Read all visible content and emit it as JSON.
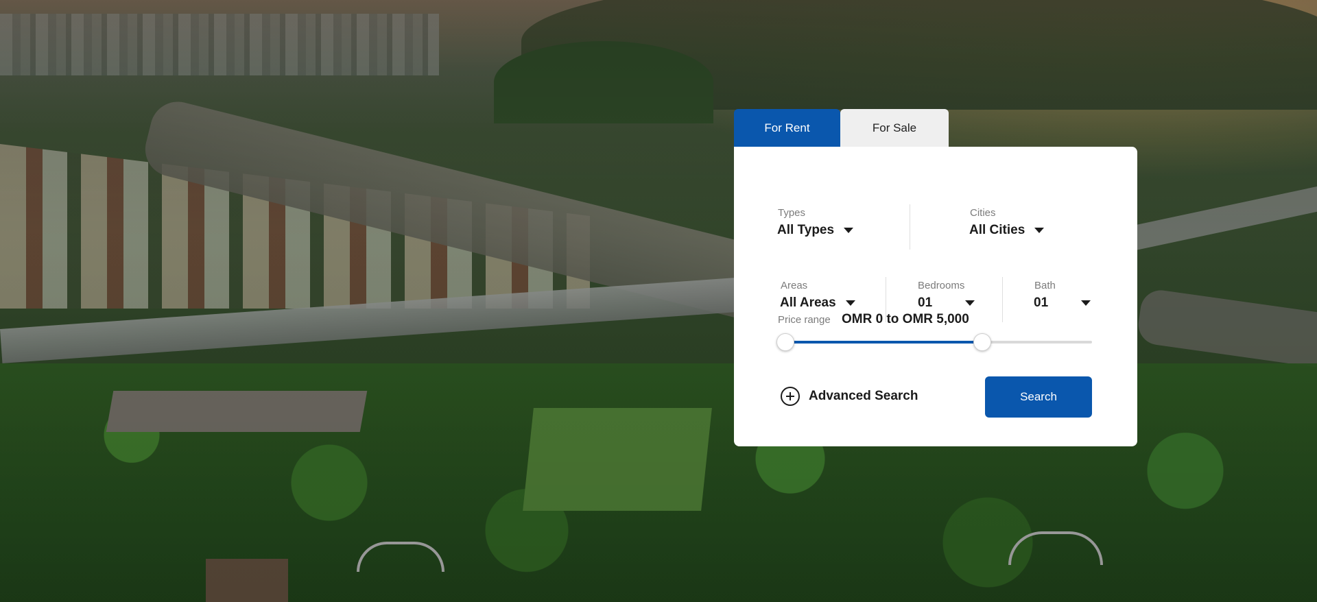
{
  "tabs": [
    {
      "label": "For Rent",
      "active": true
    },
    {
      "label": "For Sale",
      "active": false
    }
  ],
  "filters": {
    "types": {
      "label": "Types",
      "value": "All Types"
    },
    "cities": {
      "label": "Cities",
      "value": "All Cities"
    },
    "areas": {
      "label": "Areas",
      "value": "All Areas"
    },
    "bedrooms": {
      "label": "Bedrooms",
      "value": "01"
    },
    "bath": {
      "label": "Bath",
      "value": "01"
    }
  },
  "price": {
    "label": "Price range",
    "value": "OMR 0 to OMR 5,000",
    "slider_min_fraction": 0.0,
    "slider_max_fraction": 0.64
  },
  "advanced_search": {
    "label": "Advanced Search",
    "icon": "plus-circle-icon"
  },
  "search_button": {
    "label": "Search"
  },
  "colors": {
    "accent": "#0a57ad",
    "inactive_tab": "#efefef",
    "panel": "#ffffff"
  }
}
